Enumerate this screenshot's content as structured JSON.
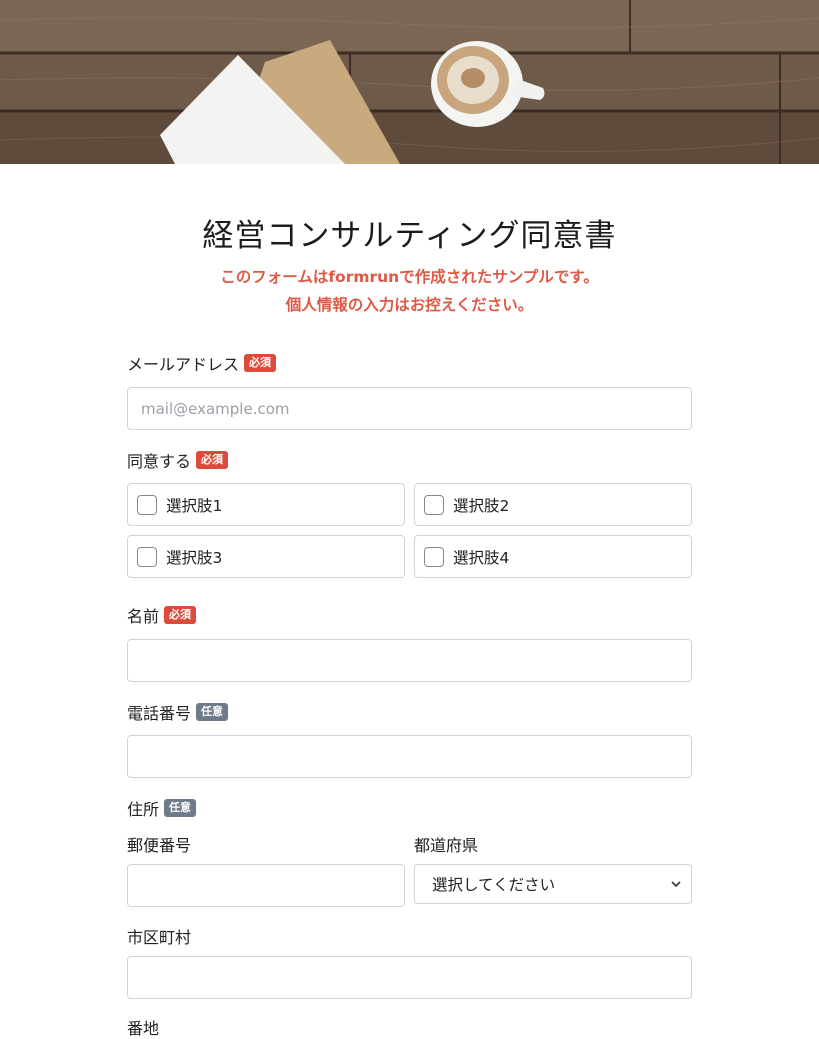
{
  "form": {
    "title": "経営コンサルティング同意書",
    "notice_line1": "このフォームはformrunで作成されたサンプルです。",
    "notice_line2": "個人情報の入力はお控えください。"
  },
  "badges": {
    "required": "必須",
    "optional": "任意"
  },
  "fields": {
    "email": {
      "label": "メールアドレス",
      "placeholder": "mail@example.com",
      "value": ""
    },
    "consent": {
      "label": "同意する",
      "options": [
        "選択肢1",
        "選択肢2",
        "選択肢3",
        "選択肢4"
      ]
    },
    "name": {
      "label": "名前",
      "value": ""
    },
    "phone": {
      "label": "電話番号",
      "value": ""
    },
    "address": {
      "label": "住所",
      "postal_label": "郵便番号",
      "prefecture_label": "都道府県",
      "prefecture_selected": "選択してください",
      "city_label": "市区町村",
      "next_label": "番地"
    }
  },
  "colors": {
    "notice": "#dc5a47",
    "required_badge": "#db4a3a",
    "optional_badge": "#6f7c88",
    "input_border": "#cfd4da"
  },
  "icons": {
    "select_chevron": "chevron-down-icon",
    "checkbox": "checkbox-icon"
  }
}
